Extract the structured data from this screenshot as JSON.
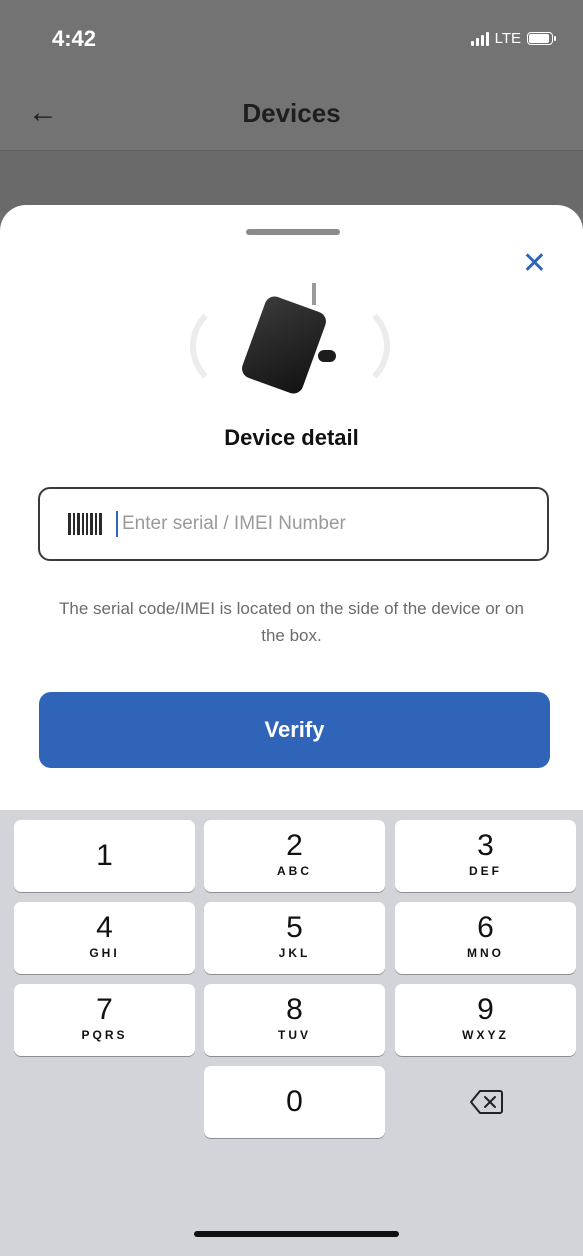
{
  "status": {
    "time": "4:42",
    "network": "LTE"
  },
  "nav": {
    "title": "Devices"
  },
  "sheet": {
    "title": "Device detail",
    "input_placeholder": "Enter serial / IMEI Number",
    "hint": "The serial code/IMEI is located on the side of the device or on the box.",
    "verify_label": "Verify"
  },
  "keypad": {
    "keys": [
      {
        "digit": "1",
        "letters": ""
      },
      {
        "digit": "2",
        "letters": "ABC"
      },
      {
        "digit": "3",
        "letters": "DEF"
      },
      {
        "digit": "4",
        "letters": "GHI"
      },
      {
        "digit": "5",
        "letters": "JKL"
      },
      {
        "digit": "6",
        "letters": "MNO"
      },
      {
        "digit": "7",
        "letters": "PQRS"
      },
      {
        "digit": "8",
        "letters": "TUV"
      },
      {
        "digit": "9",
        "letters": "WXYZ"
      },
      {
        "digit": "0",
        "letters": ""
      }
    ]
  },
  "colors": {
    "accent": "#2f64b9",
    "keyboard_bg": "#d2d4d9"
  },
  "icons": {
    "back": "arrow-left-icon",
    "close": "close-icon",
    "barcode": "barcode-icon",
    "delete": "backspace-icon"
  }
}
